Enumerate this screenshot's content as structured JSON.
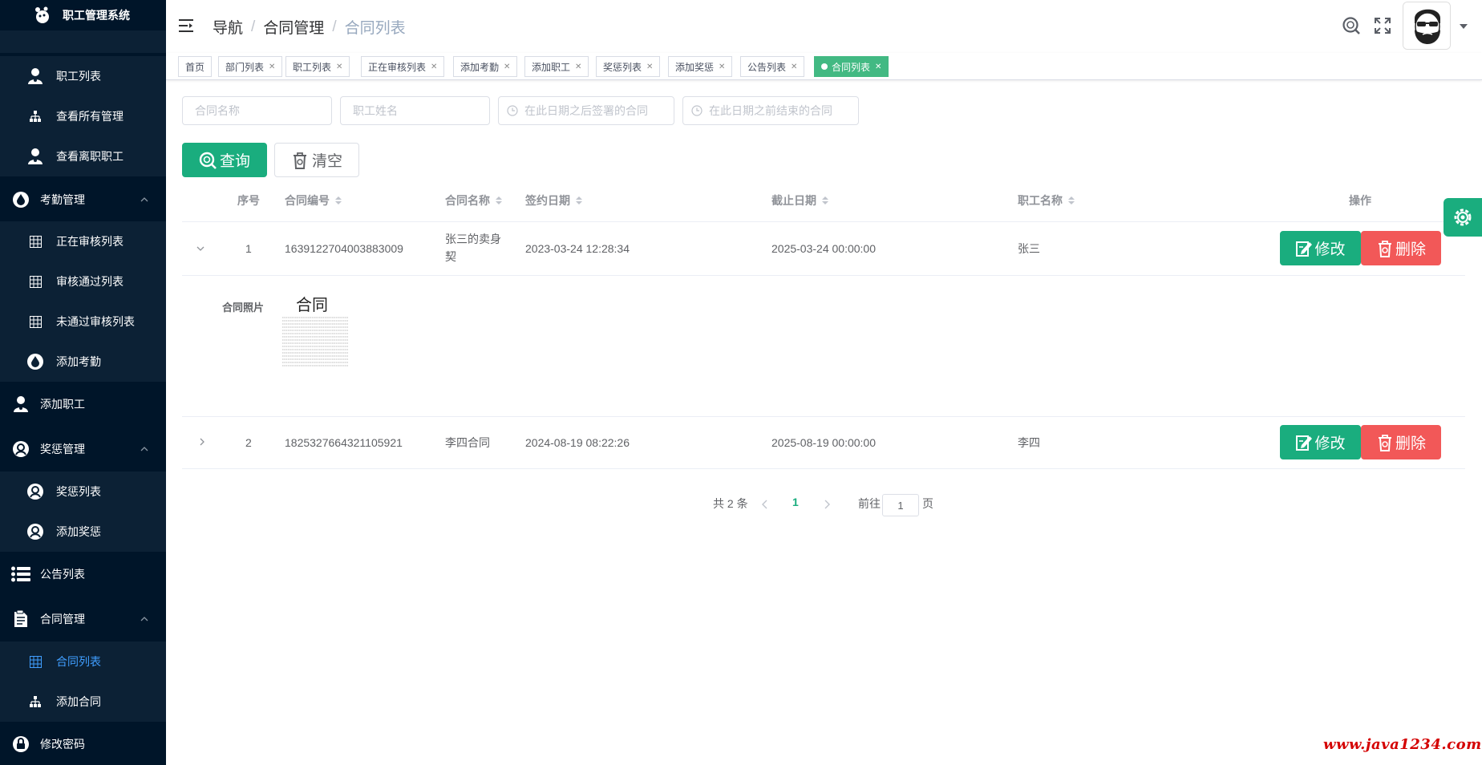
{
  "app": {
    "title": "职工管理系统"
  },
  "sidebar": {
    "items": [
      {
        "label": "职工列表",
        "icon": "user-icon"
      },
      {
        "label": "查看所有管理",
        "icon": "sitemap-icon"
      },
      {
        "label": "查看离职职工",
        "icon": "user-icon"
      },
      {
        "label": "考勤管理",
        "icon": "drop-icon"
      },
      {
        "label": "正在审核列表",
        "icon": "grid-icon"
      },
      {
        "label": "审核通过列表",
        "icon": "grid-icon"
      },
      {
        "label": "未通过审核列表",
        "icon": "grid-icon"
      },
      {
        "label": "添加考勤",
        "icon": "drop-icon"
      },
      {
        "label": "添加职工",
        "icon": "user-icon"
      },
      {
        "label": "奖惩管理",
        "icon": "badge-icon"
      },
      {
        "label": "奖惩列表",
        "icon": "badge-icon"
      },
      {
        "label": "添加奖惩",
        "icon": "badge-icon"
      },
      {
        "label": "公告列表",
        "icon": "list-icon"
      },
      {
        "label": "合同管理",
        "icon": "document-icon"
      },
      {
        "label": "合同列表",
        "icon": "grid-icon"
      },
      {
        "label": "添加合同",
        "icon": "sitemap-icon"
      },
      {
        "label": "修改密码",
        "icon": "lock-icon"
      }
    ]
  },
  "header": {
    "breadcrumb": [
      "导航",
      "合同管理",
      "合同列表"
    ]
  },
  "tags": [
    {
      "label": "首页"
    },
    {
      "label": "部门列表"
    },
    {
      "label": "职工列表"
    },
    {
      "label": "正在审核列表"
    },
    {
      "label": "添加考勤"
    },
    {
      "label": "添加职工"
    },
    {
      "label": "奖惩列表"
    },
    {
      "label": "添加奖惩"
    },
    {
      "label": "公告列表"
    },
    {
      "label": "合同列表"
    }
  ],
  "filters": {
    "contract_name": "合同名称",
    "staff_name": "职工姓名",
    "date_after": "在此日期之后签署的合同",
    "date_before": "在此日期之前结束的合同"
  },
  "buttons": {
    "query": "查询",
    "clear": "清空",
    "edit": "修改",
    "delete": "删除"
  },
  "table": {
    "headers": [
      "序号",
      "合同编号",
      "合同名称",
      "签约日期",
      "截止日期",
      "职工名称",
      "操作"
    ],
    "rows": [
      {
        "index": "1",
        "contract_no": "1639122704003883009",
        "name_line1": "张三的卖身",
        "name_line2": "契",
        "sign_date": "2023-03-24 12:28:34",
        "end_date": "2025-03-24 00:00:00",
        "staff": "张三"
      },
      {
        "index": "2",
        "contract_no": "1825327664321105921",
        "name_line1": "李四合同",
        "sign_date": "2024-08-19 08:22:26",
        "end_date": "2025-08-19 00:00:00",
        "staff": "李四"
      }
    ],
    "expanded": {
      "label": "合同照片",
      "photo_title": "合同"
    }
  },
  "pagination": {
    "total": "共 2 条",
    "current": "1",
    "goto": "前往",
    "page_value": "1",
    "page_unit": "页"
  },
  "watermark": "www.java1234.com",
  "colors": {
    "sidebar_bg": "#001529",
    "primary": "#1aad7e",
    "danger": "#f25858",
    "active_menu": "#409EFF"
  }
}
